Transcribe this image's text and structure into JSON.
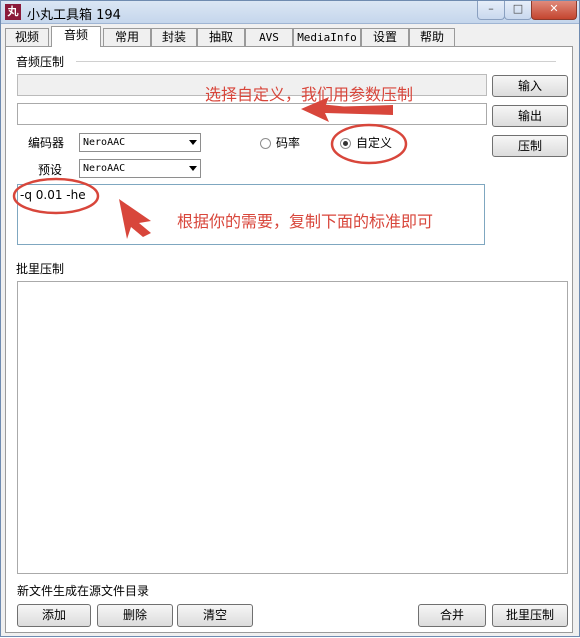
{
  "window": {
    "icon_glyph": "丸",
    "title": "小丸工具箱 194",
    "min_glyph": "–",
    "max_glyph": "□",
    "close_glyph": "✕"
  },
  "tabs": [
    {
      "label": "视频"
    },
    {
      "label": "音频",
      "active": true
    },
    {
      "label": "常用"
    },
    {
      "label": "封装"
    },
    {
      "label": "抽取"
    },
    {
      "label": "AVS"
    },
    {
      "label": "MediaInfo"
    },
    {
      "label": "设置"
    },
    {
      "label": "帮助"
    }
  ],
  "audio_compress": {
    "section_label": "音频压制",
    "input_button": "输入",
    "output_button": "输出",
    "compress_button": "压制",
    "encoder_label": "编码器",
    "encoder_value": "NeroAAC",
    "preset_label": "预设",
    "preset_value": "NeroAAC",
    "bitrate_label": "码率",
    "custom_label": "自定义",
    "custom_selected": true,
    "params_value": "-q 0.01 -he"
  },
  "annotations": {
    "custom_hint": "选择自定义，我们用参数压制",
    "params_hint": "根据你的需要，复制下面的标准即可",
    "accent_color": "#d8463b"
  },
  "batch": {
    "section_label": "批里压制",
    "footer_note": "新文件生成在源文件目录",
    "add_button": "添加",
    "delete_button": "删除",
    "clear_button": "清空",
    "merge_button": "合并",
    "batch_button": "批里压制"
  }
}
